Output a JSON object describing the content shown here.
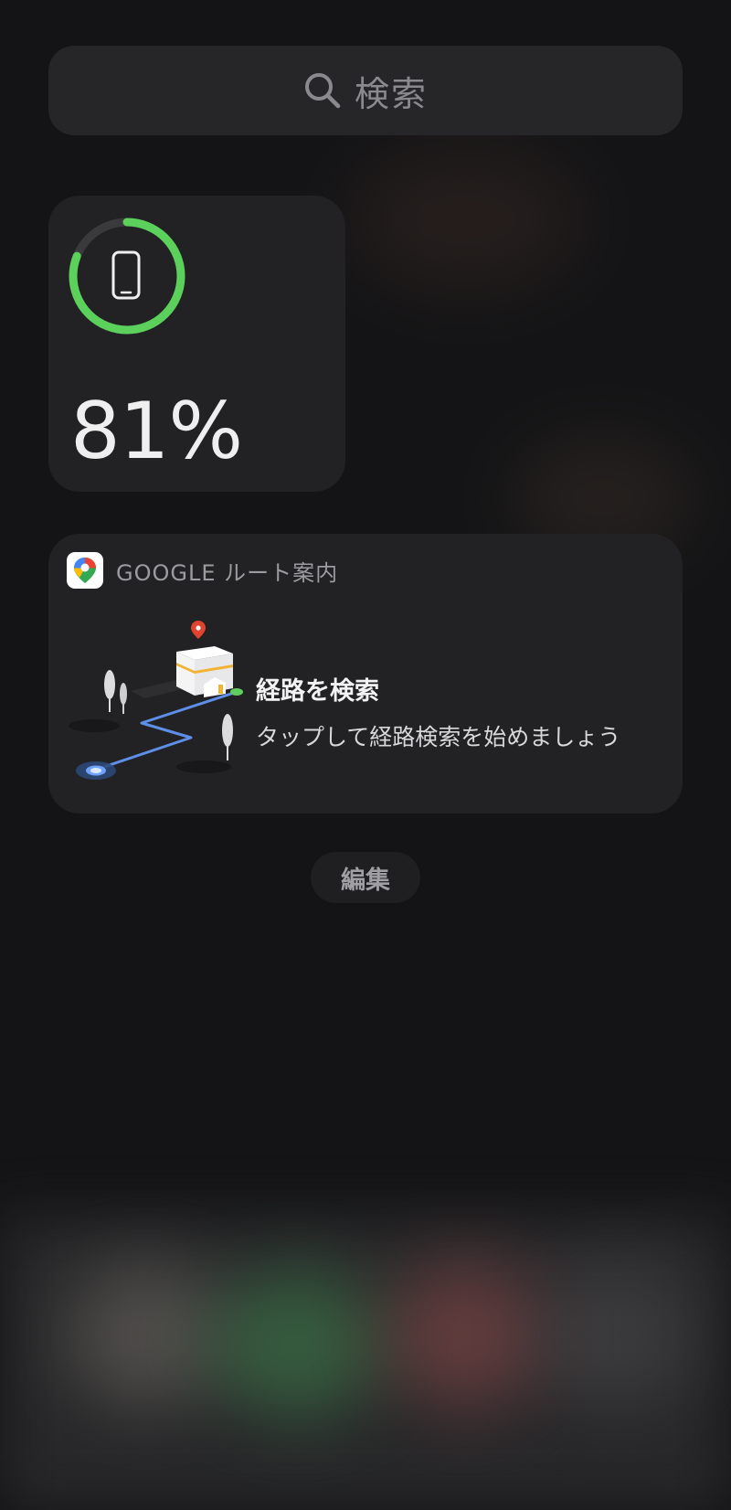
{
  "search": {
    "label": "検索",
    "icon": "search-icon"
  },
  "battery_widget": {
    "device_icon": "phone-icon",
    "level": 0.81,
    "percent_text": "81%",
    "ring_color": "#5bd15c"
  },
  "maps_widget": {
    "app_icon": "google-maps-icon",
    "header_title": "GOOGLE ルート案内",
    "title": "経路を検索",
    "subtitle": "タップして経路検索を始めましょう"
  },
  "edit_button": {
    "label": "編集"
  }
}
